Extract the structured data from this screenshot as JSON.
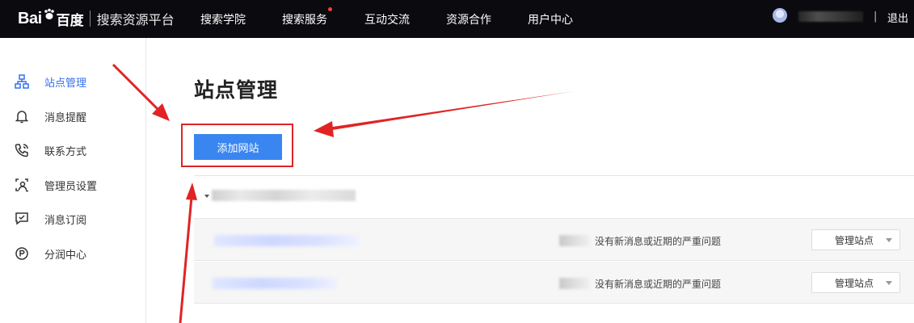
{
  "header": {
    "logo_text": "Bai",
    "logo_cn": "百度",
    "platform": "搜索资源平台",
    "nav": [
      {
        "label": "搜索学院"
      },
      {
        "label": "搜索服务",
        "has_dot": true
      },
      {
        "label": "互动交流"
      },
      {
        "label": "资源合作"
      },
      {
        "label": "用户中心"
      }
    ],
    "separator": "|",
    "logout": "退出"
  },
  "sidebar": {
    "items": [
      {
        "label": "站点管理",
        "icon": "sitemap-icon",
        "active": true
      },
      {
        "label": "消息提醒",
        "icon": "bell-icon"
      },
      {
        "label": "联系方式",
        "icon": "phone-icon"
      },
      {
        "label": "管理员设置",
        "icon": "admin-icon"
      },
      {
        "label": "消息订阅",
        "icon": "subscribe-icon"
      },
      {
        "label": "分润中心",
        "icon": "profit-icon"
      }
    ]
  },
  "main": {
    "title": "站点管理",
    "add_button": "添加网站",
    "sites": [
      {
        "status": "没有新消息或近期的严重问题",
        "action": "管理站点"
      },
      {
        "status": "没有新消息或近期的严重问题",
        "action": "管理站点"
      }
    ]
  },
  "colors": {
    "topbar": "#0b0b0f",
    "accent": "#3570ee",
    "button": "#3a86f0",
    "annotation_red": "#e02424"
  }
}
